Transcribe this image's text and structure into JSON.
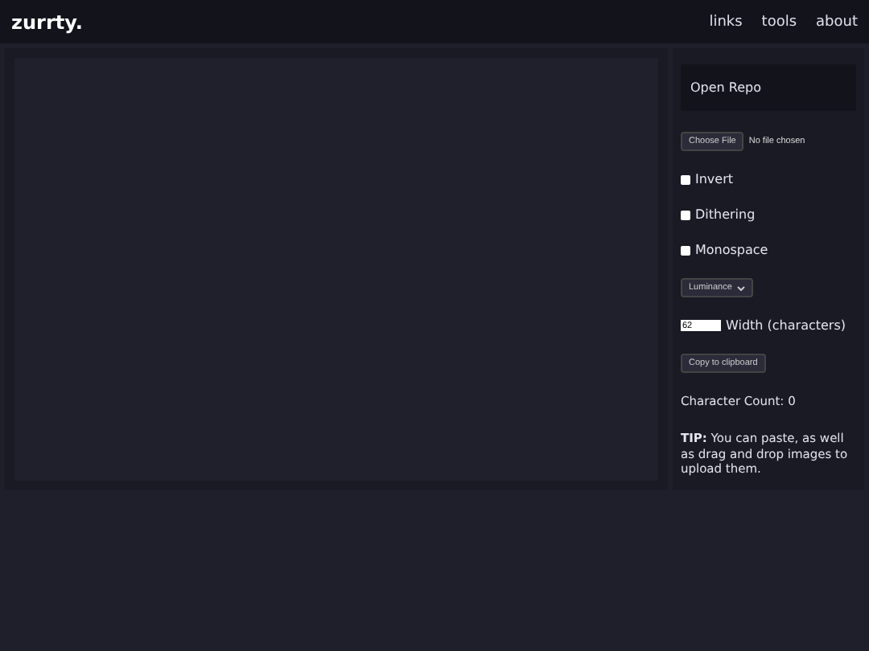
{
  "header": {
    "logo": "zurrty.",
    "nav": [
      "links",
      "tools",
      "about"
    ]
  },
  "sidebar": {
    "title": "Open Repo",
    "file": {
      "button": "Choose File",
      "status": "No file chosen"
    },
    "options": [
      {
        "label": "Invert",
        "checked": false
      },
      {
        "label": "Dithering",
        "checked": false
      },
      {
        "label": "Monospace",
        "checked": false
      }
    ],
    "mode": "Luminance",
    "width": {
      "value": "62",
      "label": "Width (characters)"
    },
    "copy_button": "Copy to clipboard",
    "count": "Character Count: 0",
    "tip": "**TIP:** You can paste, as well as drag and drop images to upload them."
  }
}
